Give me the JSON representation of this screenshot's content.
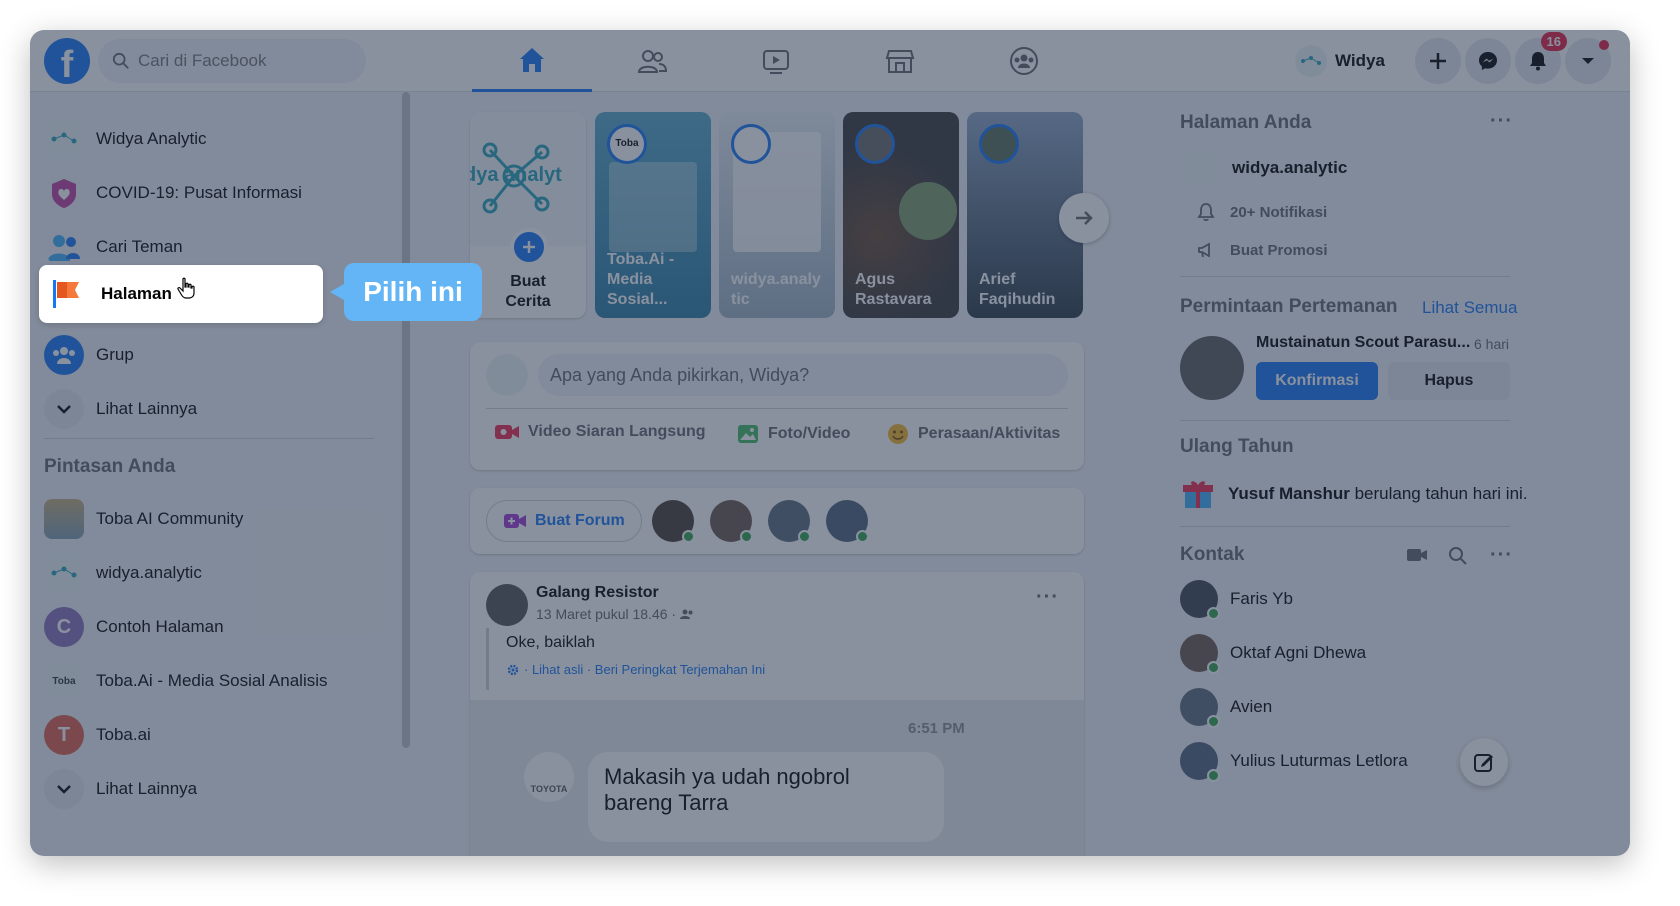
{
  "topbar": {
    "logo": "f",
    "search_placeholder": "Cari di Facebook",
    "nav_tabs": [
      "home-icon",
      "friends-icon",
      "watch-icon",
      "marketplace-icon",
      "groups-icon"
    ],
    "profile_name": "Widya",
    "notification_count": "16"
  },
  "sidebar": {
    "items": [
      {
        "label": "Widya Analytic",
        "icon": "profile-icon"
      },
      {
        "label": "COVID-19: Pusat Informasi",
        "icon": "covid-heart-icon"
      },
      {
        "label": "Cari Teman",
        "icon": "friends-icon"
      },
      {
        "label": "Halaman",
        "icon": "flag-icon"
      },
      {
        "label": "Grup",
        "icon": "group-icon"
      },
      {
        "label": "Lihat Lainnya",
        "icon": "chevron-down-icon"
      }
    ],
    "shortcuts_title": "Pintasan Anda",
    "shortcuts": [
      {
        "label": "Toba AI Community"
      },
      {
        "label": "widya.analytic"
      },
      {
        "label": "Contoh Halaman",
        "initial": "C"
      },
      {
        "label": "Toba.Ai - Media Sosial Analisis"
      },
      {
        "label": "Toba.ai",
        "initial": "T"
      },
      {
        "label": "Lihat Lainnya"
      }
    ]
  },
  "callout": "Pilih ini",
  "stories": {
    "create_line1": "Buat",
    "create_line2": "Cerita",
    "create_logo_text": "dya analyt",
    "items": [
      {
        "line1": "Toba.Ai -",
        "line2": "Media",
        "line3": "Sosial..."
      },
      {
        "line1": "widya.analy",
        "line2": "tic"
      },
      {
        "line1": "Agus",
        "line2": "Rastavara"
      },
      {
        "line1": "Arief",
        "line2": "Faqihudin"
      }
    ]
  },
  "composer": {
    "placeholder": "Apa yang Anda pikirkan, Widya?",
    "actions": [
      "Video Siaran Langsung",
      "Foto/Video",
      "Perasaan/Aktivitas"
    ]
  },
  "forum": {
    "label": "Buat Forum"
  },
  "post": {
    "author": "Galang Resistor",
    "meta": "13 Maret pukul 18.46 ·",
    "text": "Oke, baiklah",
    "translation": "· Lihat asli · Beri Peringkat Terjemahan Ini",
    "chat_time": "6:51 PM",
    "chat_text_line1": "Makasih ya udah ngobrol",
    "chat_text_line2": "bareng Tarra",
    "chat_brand": "TOYOTA"
  },
  "right": {
    "pages_title": "Halaman Anda",
    "page_name": "widya.analytic",
    "notif_text": "20+ Notifikasi",
    "promo_text": "Buat Promosi",
    "friend_req_title": "Permintaan Pertemanan",
    "see_all": "Lihat Semua",
    "req_name": "Mustainatun Scout Parasu...",
    "req_time": "6 hari",
    "confirm": "Konfirmasi",
    "delete": "Hapus",
    "bday_title": "Ulang Tahun",
    "bday_name": "Yusuf Manshur",
    "bday_text": " berulang tahun hari ini.",
    "contacts_title": "Kontak",
    "contacts": [
      "Faris Yb",
      "Oktaf Agni Dhewa",
      "Avien",
      "Yulius Luturmas Letlora"
    ]
  },
  "colors": {
    "brand": "#1877f2",
    "callout": "#64b5f6",
    "online": "#31a24c",
    "badge": "#e41e3f"
  }
}
